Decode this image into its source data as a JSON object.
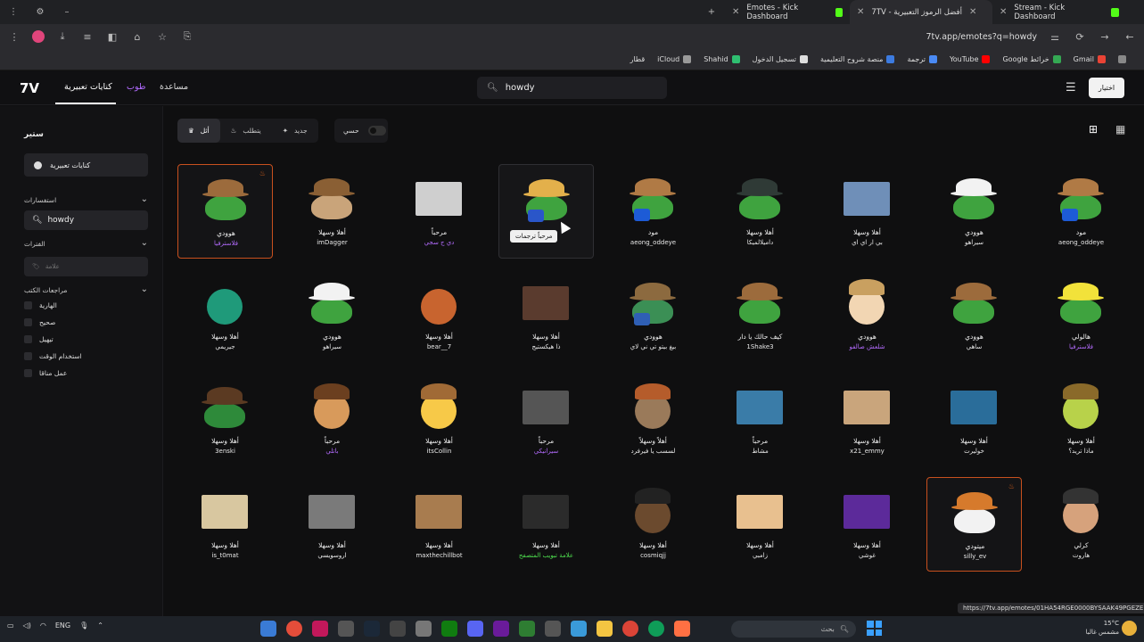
{
  "browser": {
    "tabs": [
      {
        "title": "Stream - Kick Dashboard"
      },
      {
        "title": "7TV - أفضل الرموز التعبيرية"
      },
      {
        "title": "Emotes - Kick Dashboard"
      }
    ],
    "url": "7tv.app/emotes?q=howdy",
    "bookmarks": [
      "Gmail",
      "Google خرائط",
      "YouTube",
      "ترجمة",
      "منصة شروح التعليمية",
      "تسجيل الدخول",
      "Shahid",
      "iCloud",
      "قطار"
    ]
  },
  "header": {
    "logo": "7V",
    "nav": [
      {
        "label": "كنايات تعبيرية"
      },
      {
        "label": "طوب"
      },
      {
        "label": "مساعدة"
      }
    ],
    "search_value": "howdy",
    "signin_label": "اختيار"
  },
  "sidebar": {
    "title": "ستير",
    "chip_label": "كنايات تعبيرية",
    "section_search": "استفسارات",
    "search_value": "howdy",
    "section_tags": "الفترات",
    "tags_placeholder": "علامة",
    "section_filters": "مراجعات الكتب",
    "checks": [
      "الهارية",
      "صحيح",
      "تيهيل",
      "استخدام الوقت",
      "عمل مناقا"
    ]
  },
  "filters": {
    "buttons": [
      {
        "label": "أثل",
        "icon": "trophy-icon"
      },
      {
        "label": "يتطلب",
        "icon": "fire-icon"
      },
      {
        "label": "جديد",
        "icon": "sparkle-icon"
      }
    ],
    "toggle_label": "حسي"
  },
  "tooltip": "مرحباً ترجمات",
  "emotes": [
    [
      {
        "name": "هوودي",
        "owner": "فلاسترفيا",
        "owner_color": "purple",
        "kind": "pepe-cowboy",
        "selected": true
      },
      {
        "name": "أهلا وسهلا",
        "owner": "imDagger",
        "kind": "cat-cowboy"
      },
      {
        "name": "مرحباً",
        "owner": "دي ج سجي",
        "owner_color": "purple",
        "kind": "photo-dark"
      },
      {
        "name": "",
        "owner": "",
        "kind": "pepe-straw",
        "hover": true
      },
      {
        "name": "مود",
        "owner": "aeong_oddeye",
        "kind": "pepe-cowboy-hand"
      },
      {
        "name": "أهلا وسهلا",
        "owner": "داميلالميكا",
        "kind": "pepe-dark"
      },
      {
        "name": "أهلا وسهلا",
        "owner": "بي ار اي اي",
        "kind": "photo-sky"
      },
      {
        "name": "هوودي",
        "owner": "سيراهو",
        "kind": "pepe-white"
      },
      {
        "name": "مود",
        "owner": "aeong_oddeye",
        "kind": "pepe-cowboy-hand"
      }
    ],
    [
      {
        "name": "أهلا وسهلا",
        "owner": "جيريمي",
        "kind": "green-face"
      },
      {
        "name": "هوودي",
        "owner": "سيراهو",
        "kind": "pepe-white"
      },
      {
        "name": "أهلا وسهلا",
        "owner": "bear__7",
        "kind": "anime-red"
      },
      {
        "name": "أهلا وسهلا",
        "owner": "ذا هيكستيج",
        "kind": "anime-eyes"
      },
      {
        "name": "هوودي",
        "owner": "بيغ بيتو تي ني لاي",
        "kind": "pepe-blue"
      },
      {
        "name": "كيف حالك يا دار",
        "owner": "1Shake3",
        "kind": "pepe-cowboy"
      },
      {
        "name": "هوودي",
        "owner": "شلعش صالفو",
        "owner_color": "purple",
        "kind": "anime-cat"
      },
      {
        "name": "هوودي",
        "owner": "ساهي",
        "kind": "pepe-cowboy"
      },
      {
        "name": "هالولي",
        "owner": "فلاسترفيا",
        "owner_color": "purple",
        "kind": "pepe-halo"
      }
    ],
    [
      {
        "name": "أهلا وسهلا",
        "owner": "3enski",
        "kind": "pepe-cowboy-dark"
      },
      {
        "name": "مرحباً",
        "owner": "باتلي",
        "owner_color": "purple",
        "kind": "woody"
      },
      {
        "name": "أهلا وسهلا",
        "owner": "itsCollin",
        "kind": "emoji-cowboy"
      },
      {
        "name": "مرحباً",
        "owner": "سيرانيكي",
        "owner_color": "purple",
        "kind": "photo-bw"
      },
      {
        "name": "أهلاً وسهلاً",
        "owner": "لسسب يا فيرفرد",
        "kind": "dog-cowboy"
      },
      {
        "name": "مرحباً",
        "owner": "مشاط",
        "kind": "tom-jerry"
      },
      {
        "name": "أهلا وسهلا",
        "owner": "x21_emmy",
        "kind": "photo-woman"
      },
      {
        "name": "أهلا وسهلا",
        "owner": "خوليرت",
        "kind": "photo-blue"
      },
      {
        "name": "أهلا وسهلا",
        "owner": "ماذا تريد؟",
        "kind": "turtle"
      }
    ],
    [
      {
        "name": "أهلا وسهلا",
        "owner": "is_t0mat",
        "kind": "photo-cowboy"
      },
      {
        "name": "أهلا وسهلا",
        "owner": "اروسويسي",
        "kind": "photo-cat"
      },
      {
        "name": "أهلا وسهلا",
        "owner": "maxthechillbot",
        "kind": "photo-cat-hat"
      },
      {
        "name": "أهلا وسهلا",
        "owner": "علامة تبويب المتصفح",
        "owner_color": "green",
        "kind": "browser-tab"
      },
      {
        "name": "أهلا وسهلا",
        "owner": "cosmiqjj",
        "kind": "horse"
      },
      {
        "name": "أهلا وسهلا",
        "owner": "زامبي",
        "kind": "photo-kitty"
      },
      {
        "name": "أهلا وسهلا",
        "owner": "غوشي",
        "kind": "photo-purple"
      },
      {
        "name": "ميتودي",
        "owner": "silly_ev",
        "kind": "cat-hat-orange",
        "selected": true
      },
      {
        "name": "كرلي",
        "owner": "هاروت",
        "kind": "photo-man"
      }
    ]
  ],
  "status_url": "https://7tv.app/emotes/01HA54RGE0000BYSAAK49PGEZE",
  "taskbar": {
    "lang": "ENG",
    "search_placeholder": "بحث",
    "weather_temp": "15°C",
    "weather_desc": "مشمس غالبا"
  }
}
